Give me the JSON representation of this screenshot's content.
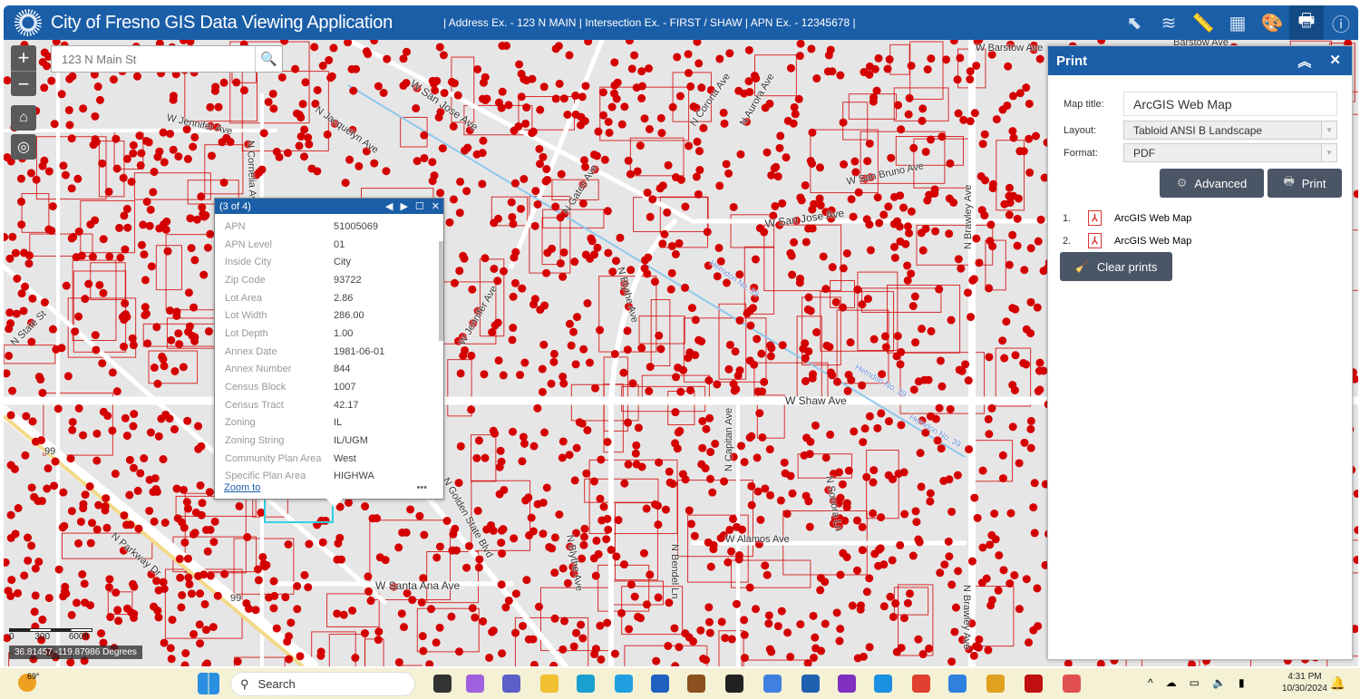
{
  "header": {
    "title": "City of Fresno GIS Data Viewing Application",
    "hint": "| Address Ex. - 123 N MAIN | Intersection Ex. - FIRST / SHAW | APN Ex. - 12345678 |",
    "tools": [
      {
        "icon": "select-icon"
      },
      {
        "icon": "layers-icon"
      },
      {
        "icon": "measure-icon"
      },
      {
        "icon": "basemap-gallery-icon"
      },
      {
        "icon": "palette-icon"
      },
      {
        "icon": "print-icon",
        "active": true
      },
      {
        "icon": "info-icon"
      }
    ],
    "accent": "#1b5ea8"
  },
  "search": {
    "placeholder": "123 N Main St"
  },
  "map": {
    "zoom_in": "+",
    "zoom_out": "−",
    "streets": [
      "W Barstow Ave",
      "W San Jose Ave",
      "W Jennifer Ave",
      "N Cornelia Ave",
      "N Jacquelyn Ave",
      "N Gates Ave",
      "N Blythe Ave",
      "W San Jose Ave",
      "W Shaw Ave",
      "N Brawley Ave",
      "W San Bruno Ave",
      "N Corona Ave",
      "N Aurora Ave",
      "N State St",
      "W Jennifer Ave",
      "N Golden State Blvd",
      "N Blythe Ave",
      "N Capitan Ave",
      "N Sonora Ln",
      "N Bendel Ln",
      "W Alamos Ave",
      "N Brawley Ave",
      "W Santa Ana Ave",
      "N Parkway Dr",
      "Herndon No. 39",
      "Herndon No. 39",
      "Herndon No. 39",
      "99",
      "99",
      "Barstow Ave"
    ],
    "scale": {
      "labels": [
        "0",
        "300",
        "600ft"
      ]
    },
    "coordinates": "36.81457 -119.87986 Degrees",
    "parcel_color": "#d40000"
  },
  "popup": {
    "counter": "(3 of 4)",
    "fields": [
      {
        "k": "APN",
        "v": "51005069"
      },
      {
        "k": "APN Level",
        "v": "01"
      },
      {
        "k": "Inside City",
        "v": "City"
      },
      {
        "k": "Zip Code",
        "v": "93722"
      },
      {
        "k": "Lot Area",
        "v": "2.86"
      },
      {
        "k": "Lot Width",
        "v": "286.00"
      },
      {
        "k": "Lot Depth",
        "v": "1.00"
      },
      {
        "k": "Annex Date",
        "v": "1981-06-01"
      },
      {
        "k": "Annex Number",
        "v": "844"
      },
      {
        "k": "Census Block",
        "v": "1007"
      },
      {
        "k": "Census Tract",
        "v": "42.17"
      },
      {
        "k": "Zoning",
        "v": "IL"
      },
      {
        "k": "Zoning String",
        "v": "IL/UGM"
      },
      {
        "k": "Community Plan Area",
        "v": "West"
      },
      {
        "k": "Specific Plan Area",
        "v": "HIGHWA"
      }
    ],
    "zoom_to": "Zoom to",
    "more": "•••"
  },
  "print": {
    "title": "Print",
    "map_title_label": "Map title:",
    "map_title_value": "ArcGIS Web Map",
    "layout_label": "Layout:",
    "layout_value": "Tabloid ANSI B Landscape",
    "format_label": "Format:",
    "format_value": "PDF",
    "advanced": "Advanced",
    "print": "Print",
    "prints": [
      {
        "n": "1.",
        "name": "ArcGIS Web Map"
      },
      {
        "n": "2.",
        "name": "ArcGIS Web Map"
      }
    ],
    "clear": "Clear prints"
  },
  "taskbar": {
    "weather": "69°",
    "search": "Search",
    "time": "4:31 PM",
    "date": "10/30/2024"
  }
}
